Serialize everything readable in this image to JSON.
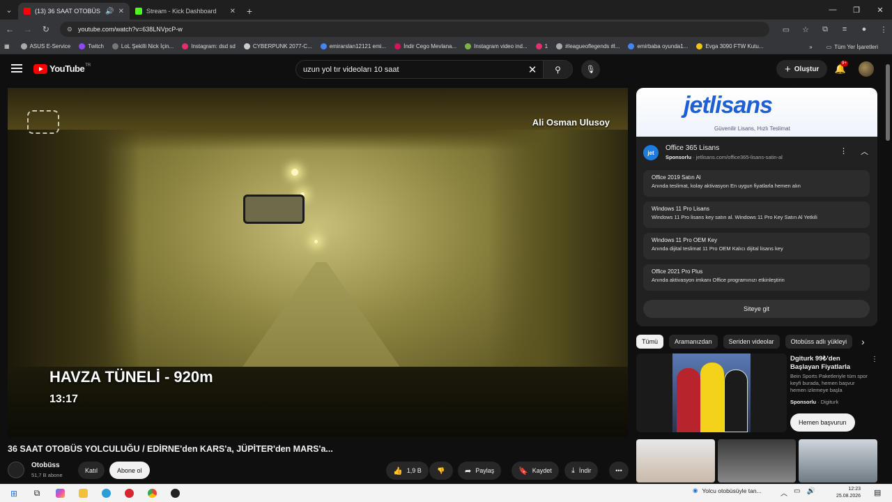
{
  "browser": {
    "tabs": [
      {
        "title": "(13) 36 SAAT OTOBÜS YOLC",
        "fav_color": "#ff0000",
        "active": true
      },
      {
        "title": "Stream - Kick Dashboard",
        "fav_color": "#53fc18",
        "active": false
      }
    ],
    "url": "youtube.com/watch?v=638LNVpcP-w",
    "bookmarks": [
      {
        "label": "ASUS E-Service",
        "color": "#aaaaaa"
      },
      {
        "label": "Twitch",
        "color": "#9146ff"
      },
      {
        "label": "LoL Şekilli Nick İçin...",
        "color": "#777777"
      },
      {
        "label": "Instagram: dsd sd",
        "color": "#e1306c"
      },
      {
        "label": "CYBERPUNK 2077-C...",
        "color": "#cccccc"
      },
      {
        "label": "emirarslan12121 emi...",
        "color": "#4285f4"
      },
      {
        "label": "İndir Cego Mevlana...",
        "color": "#d4145a"
      },
      {
        "label": "Instagram video ind...",
        "color": "#7cb342"
      },
      {
        "label": "1",
        "color": "#e1306c"
      },
      {
        "label": "#leagueoflegends #l...",
        "color": "#aaaaaa"
      },
      {
        "label": "emirbaba oyunda1...",
        "color": "#4285f4"
      },
      {
        "label": "Evga 3090 FTW Kutu...",
        "color": "#f1c40f"
      }
    ],
    "bookmarks_more": "»",
    "all_bookmarks": "Tüm Yer İşaretleri"
  },
  "youtube": {
    "logo_text": "YouTube",
    "logo_sup": "TR",
    "search_value": "uzun yol tır videoları 10 saat",
    "create_label": "Oluştur",
    "notif_badge": "9+"
  },
  "video": {
    "watermark": "Ali Osman Ulusoy",
    "overlay_title": "HAVZA TÜNELİ - 920m",
    "overlay_time": "13:17",
    "title": "36 SAAT OTOBÜS YOLCULUĞU / EDİRNE'den KARS'a, JÜPİTER'den MARS'a...",
    "channel": "Otobüss",
    "subs": "51,7 B abone",
    "join": "Katıl",
    "subscribe": "Abone ol",
    "likes": "1,9 B",
    "share": "Paylaş",
    "save": "Kaydet",
    "download": "İndir"
  },
  "ad": {
    "brand_logo": "jetlisans",
    "brand_tagline": "Güvenilir Lisans, Hızlı Teslimat",
    "icon_text": "jet",
    "title": "Office 365 Lisans",
    "sponsored": "Sponsorlu",
    "domain": "· jetlisans.com/office365-lisans-satin-al",
    "rows": [
      {
        "title": "Office 2019 Satın Al",
        "desc": "Anında teslimat, kolay aktivasyon En uygun fiyatlarla hemen alın"
      },
      {
        "title": "Windows 11 Pro Lisans",
        "desc": "Windows 11 Pro lisans key satın al. Windows 11 Pro Key Satın Al Yetkili"
      },
      {
        "title": "Windows 11 Pro OEM Key",
        "desc": "Anında dijital teslimat 11 Pro OEM Kalıcı dijital lisans key"
      },
      {
        "title": "Office 2021 Pro Plus",
        "desc": "Anında aktivasyon imkanı Office programınızı etkinleştirin"
      }
    ],
    "cta": "Siteye git"
  },
  "chips": [
    "Tümü",
    "Aramanızdan",
    "Seriden videolar",
    "Otobüss adlı yükleyi"
  ],
  "promo": {
    "title": "Dgiturk 99₺'den Başlayan Fiyatlarla",
    "desc": "Bein Sports Paketleriyle tüm spor keyfi burada, hemen başvur hemen izlemeye başla",
    "sponsored": "Sponsorlu",
    "advertiser": "· Digiturk",
    "cta": "Hemen başvurun"
  },
  "taskbar": {
    "news": "Yolcu otobüsüyle tan...",
    "time": "12:23",
    "date": "25.08.2026"
  }
}
